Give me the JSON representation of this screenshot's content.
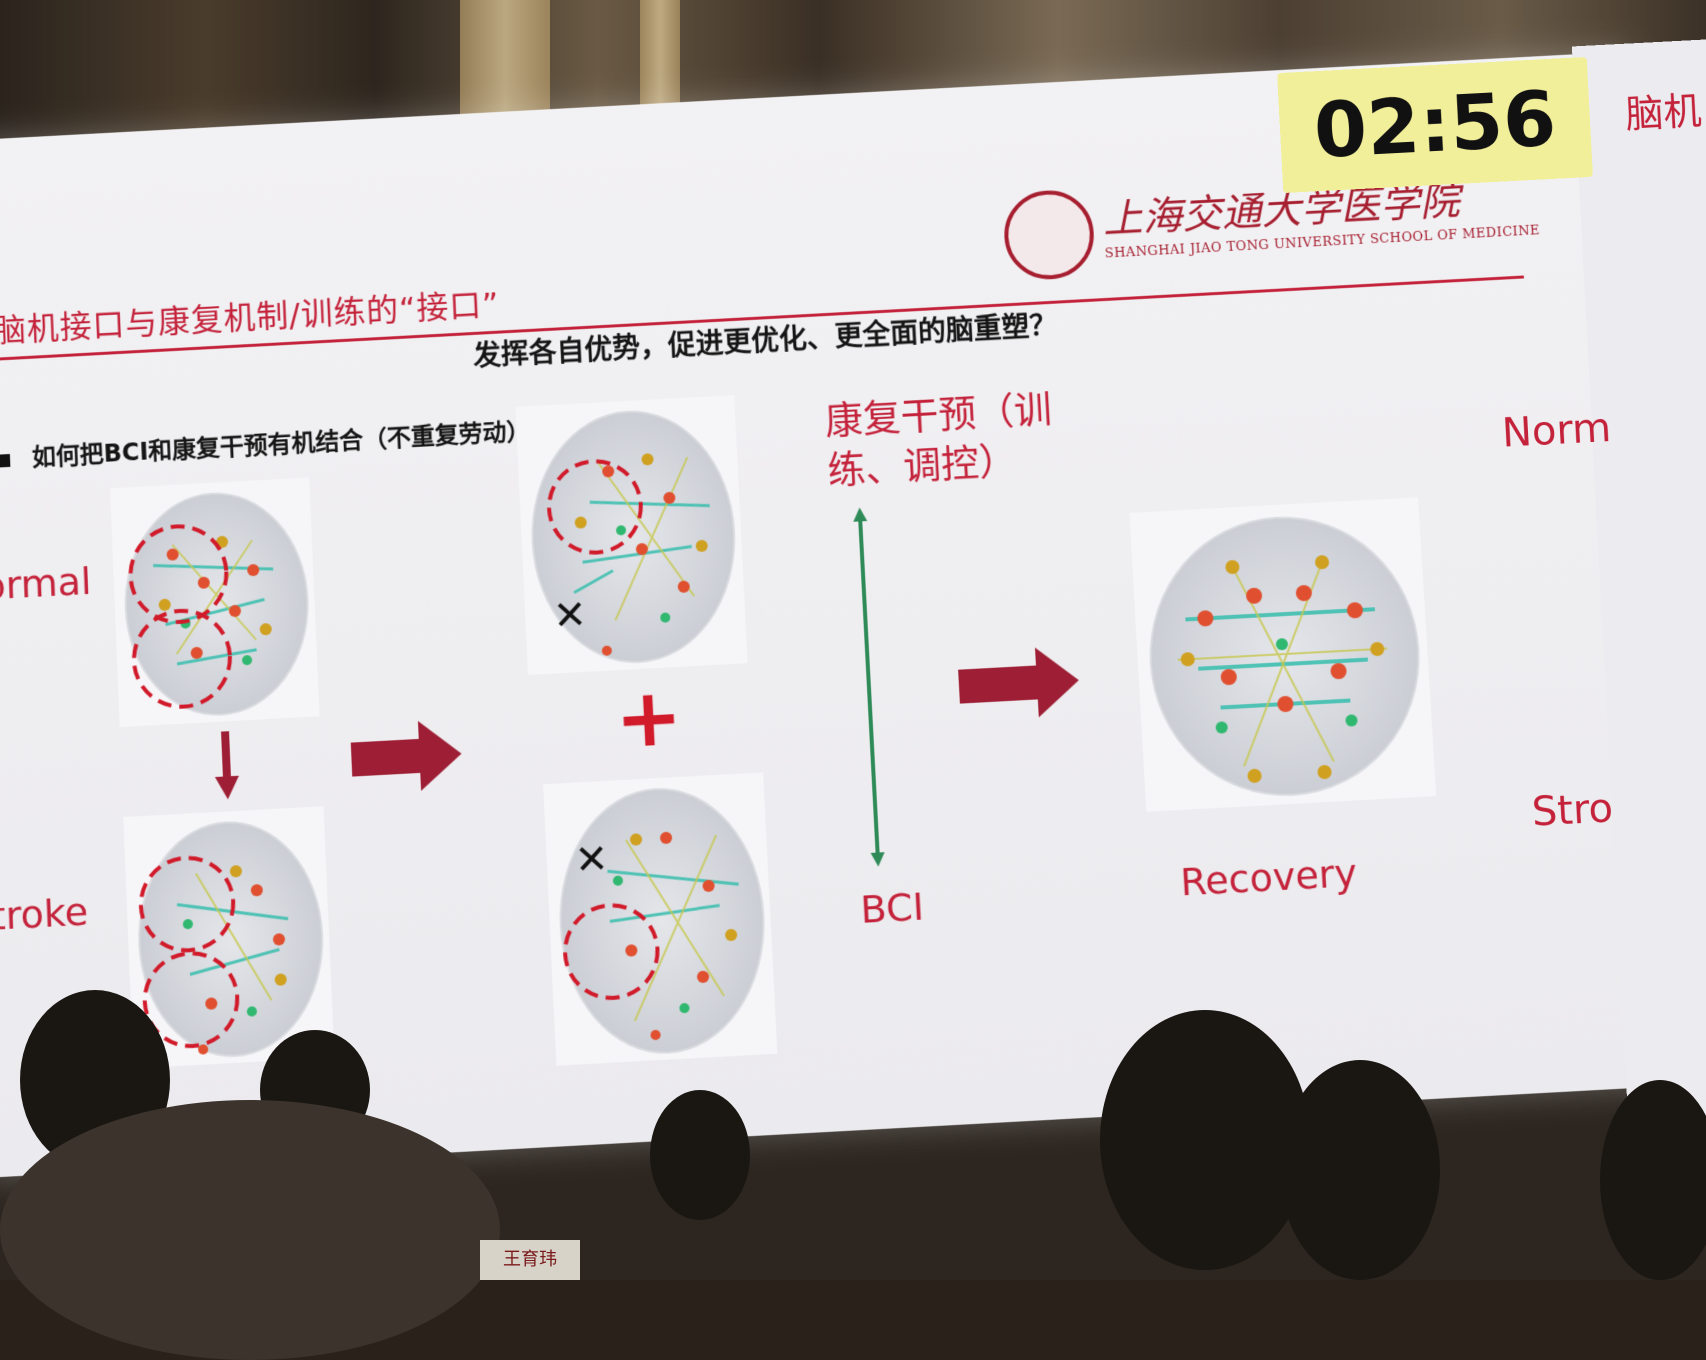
{
  "slide": {
    "title": "脑机接口与康复机制/训练的“接口”",
    "question": "发挥各自优势，促进更优化、更全面的脑重塑？",
    "bullet": "如何把BCI和康复干预有机结合（不重复劳动），",
    "labels": {
      "normal": "Normal",
      "stroke": "Stroke",
      "rehab_line1": "康复干预（训",
      "rehab_line2": "练、调控）",
      "bci": "BCI",
      "recovery": "Recovery",
      "plus": "+",
      "cross": "✕"
    },
    "colors": {
      "accent": "#c4223a",
      "arrow": "#9e1f35",
      "axis": "#2e8b57"
    }
  },
  "logo": {
    "cn_name": "上海交通大学医学院",
    "en_name": "SHANGHAI JIAO TONG UNIVERSITY SCHOOL OF MEDICINE"
  },
  "timer": {
    "value": "02:56"
  },
  "next_slide": {
    "title_fragment": "脑机",
    "label_normal": "Norm",
    "label_stroke": "Stro"
  },
  "name_card": {
    "text": "王育玮"
  }
}
